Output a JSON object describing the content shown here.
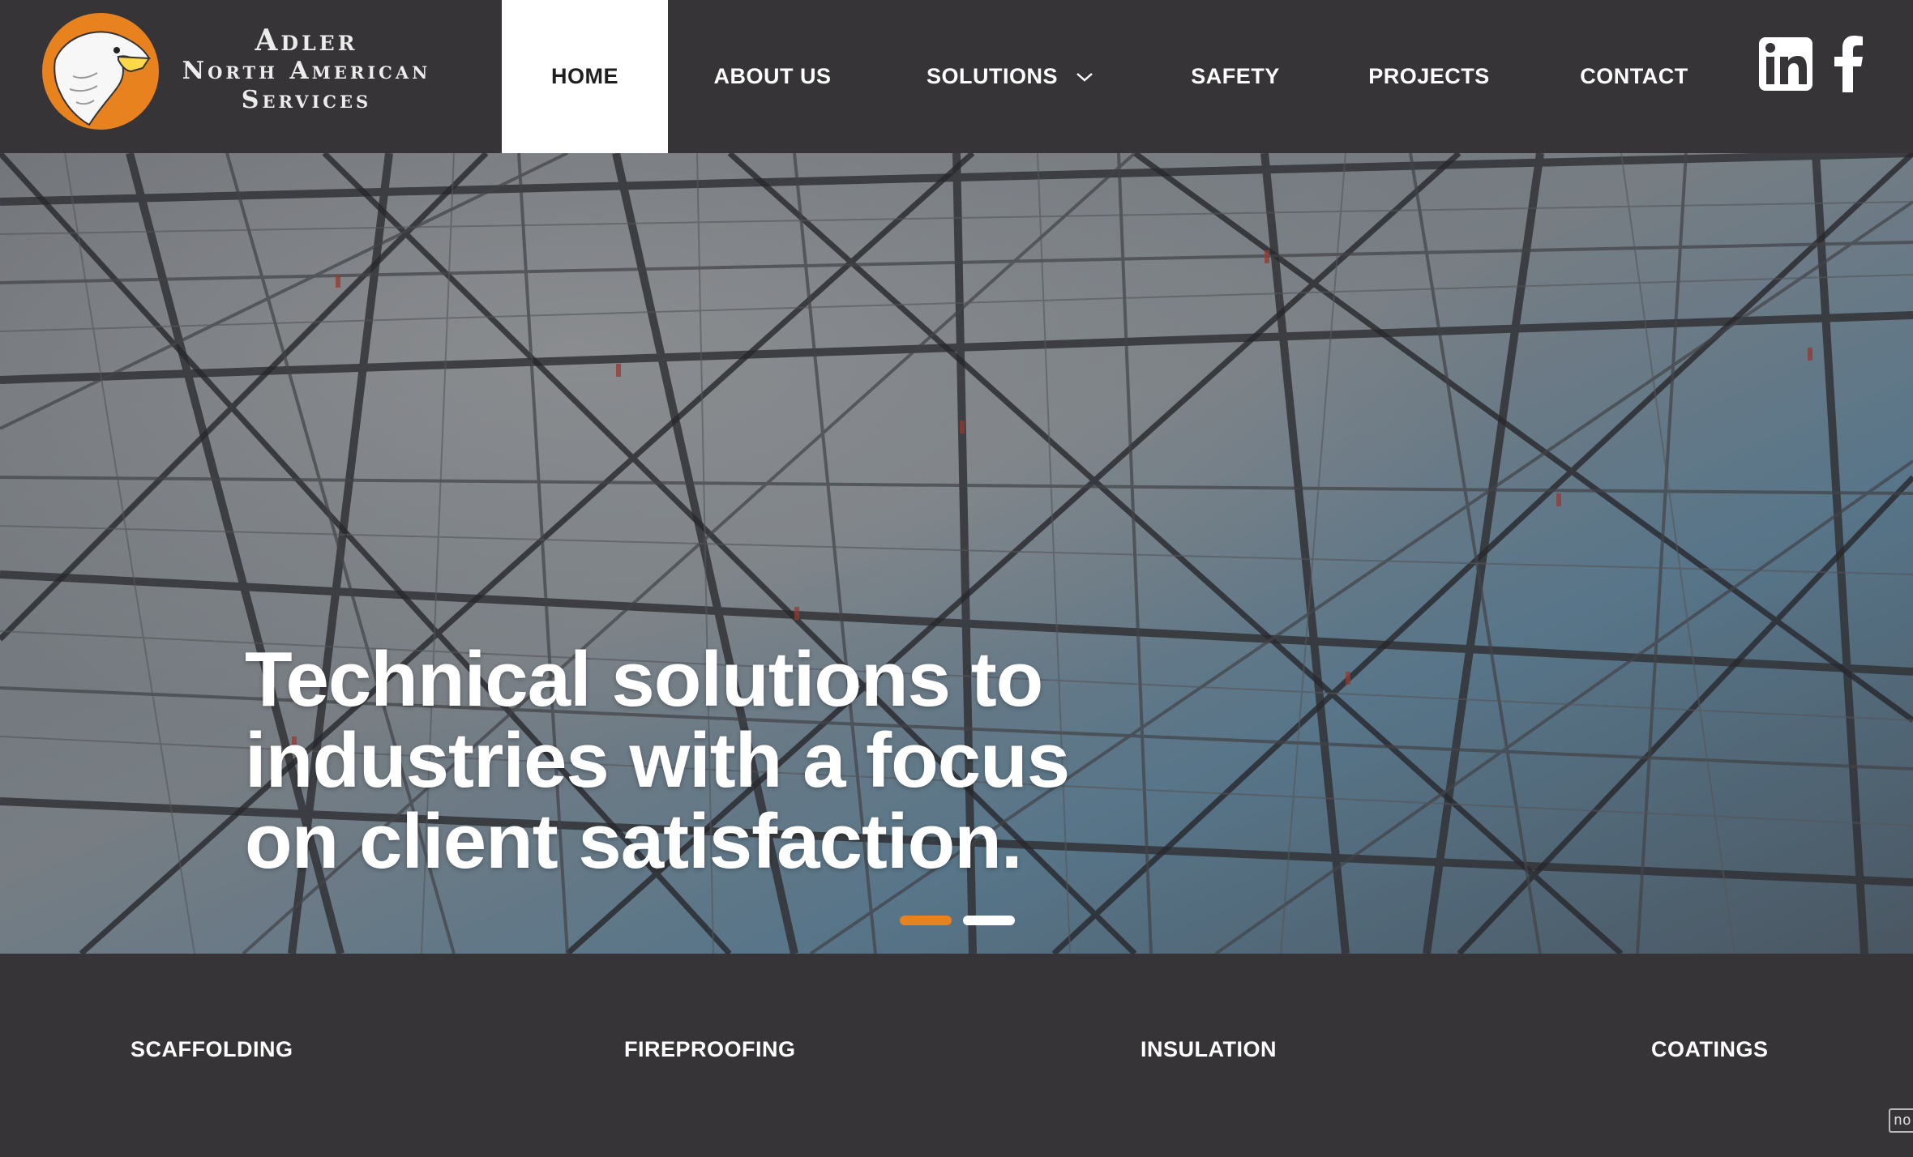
{
  "brand": {
    "line1": "Adler",
    "line2": "North American",
    "line3": "Services"
  },
  "nav": {
    "items": [
      {
        "label": "HOME",
        "active": true
      },
      {
        "label": "ABOUT US",
        "active": false
      },
      {
        "label": "SOLUTIONS",
        "active": false,
        "has_dropdown": true
      },
      {
        "label": "SAFETY",
        "active": false
      },
      {
        "label": "PROJECTS",
        "active": false
      },
      {
        "label": "CONTACT",
        "active": false
      }
    ]
  },
  "social": {
    "linkedin_icon": "linkedin-icon",
    "facebook_icon": "facebook-icon"
  },
  "hero": {
    "headline_line1": "Technical solutions to",
    "headline_line2": "industries with a focus",
    "headline_line3": "on client satisfaction.",
    "slides": [
      {
        "active": true
      },
      {
        "active": false
      }
    ]
  },
  "services": {
    "items": [
      "SCAFFOLDING",
      "FIREPROOFING",
      "INSULATION",
      "COATINGS"
    ]
  },
  "corner_badge": "no",
  "colors": {
    "header_bg": "#363436",
    "accent": "#e8821f",
    "active_tab_bg": "#ffffff"
  }
}
